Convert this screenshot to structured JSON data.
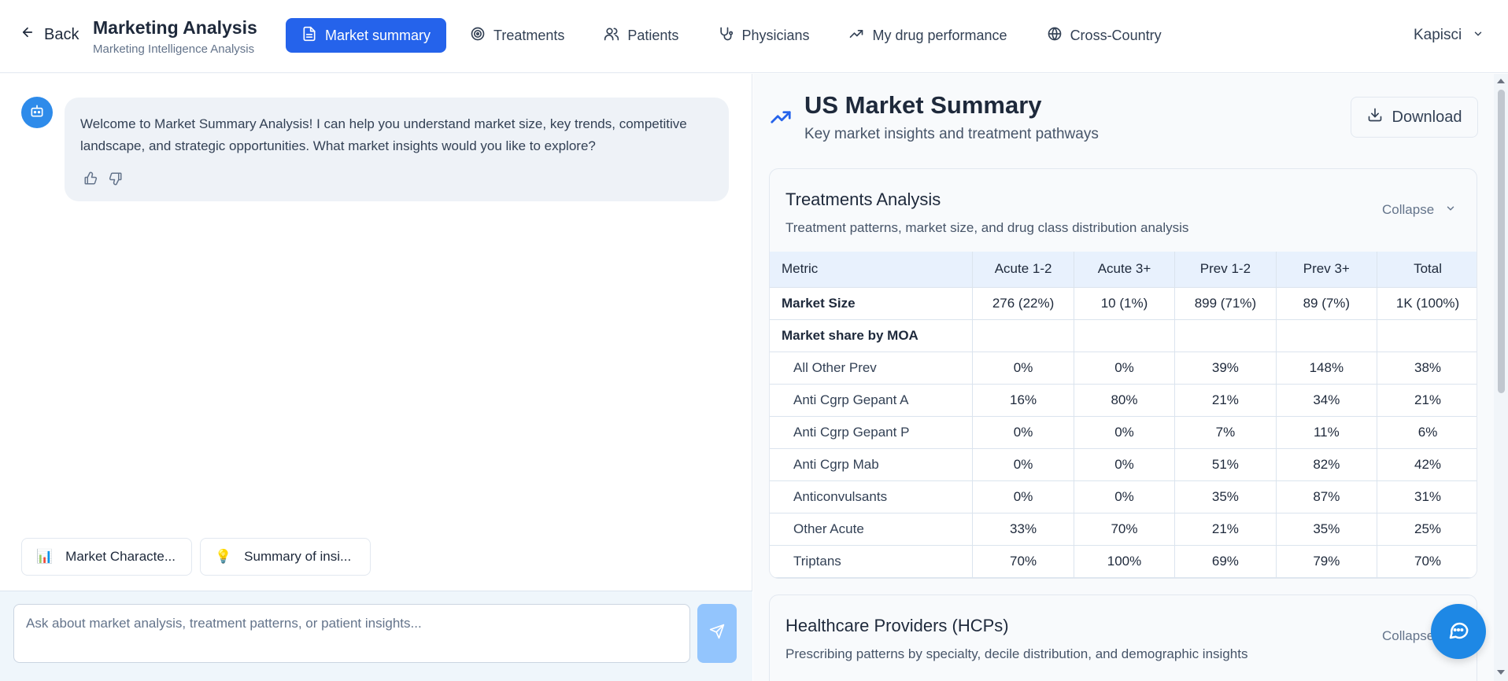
{
  "header": {
    "back_label": "Back",
    "title": "Marketing Analysis",
    "subtitle": "Marketing Intelligence Analysis",
    "tabs": [
      {
        "label": "Market summary",
        "icon": "document-icon",
        "active": true
      },
      {
        "label": "Treatments",
        "icon": "target-icon",
        "active": false
      },
      {
        "label": "Patients",
        "icon": "users-icon",
        "active": false
      },
      {
        "label": "Physicians",
        "icon": "stethoscope-icon",
        "active": false
      },
      {
        "label": "My drug performance",
        "icon": "trending-up-icon",
        "active": false
      },
      {
        "label": "Cross-Country",
        "icon": "globe-icon",
        "active": false
      }
    ],
    "user": "Kapisci"
  },
  "chat": {
    "welcome": "Welcome to Market Summary Analysis! I can help you understand market size, key trends, competitive landscape, and strategic opportunities. What market insights would you like to explore?",
    "chips": [
      {
        "emoji": "📊",
        "label": "Market Characte..."
      },
      {
        "emoji": "💡",
        "label": "Summary of insi..."
      }
    ],
    "input_placeholder": "Ask about market analysis, treatment patterns, or patient insights..."
  },
  "summary": {
    "title": "US Market Summary",
    "subtitle": "Key market insights and treatment pathways",
    "download_label": "Download"
  },
  "treatments": {
    "title": "Treatments Analysis",
    "subtitle": "Treatment patterns, market size, and drug class distribution analysis",
    "collapse_label": "Collapse",
    "columns": [
      "Metric",
      "Acute 1-2",
      "Acute 3+",
      "Prev 1-2",
      "Prev 3+",
      "Total"
    ],
    "market_size": {
      "label": "Market Size",
      "values": [
        "276 (22%)",
        "10 (1%)",
        "899 (71%)",
        "89 (7%)",
        "1K (100%)"
      ]
    },
    "moa_header": "Market share by MOA",
    "rows": [
      {
        "label": "All Other Prev",
        "values": [
          "0%",
          "0%",
          "39%",
          "148%",
          "38%"
        ]
      },
      {
        "label": "Anti Cgrp Gepant A",
        "values": [
          "16%",
          "80%",
          "21%",
          "34%",
          "21%"
        ]
      },
      {
        "label": "Anti Cgrp Gepant P",
        "values": [
          "0%",
          "0%",
          "7%",
          "11%",
          "6%"
        ]
      },
      {
        "label": "Anti Cgrp Mab",
        "values": [
          "0%",
          "0%",
          "51%",
          "82%",
          "42%"
        ]
      },
      {
        "label": "Anticonvulsants",
        "values": [
          "0%",
          "0%",
          "35%",
          "87%",
          "31%"
        ]
      },
      {
        "label": "Other Acute",
        "values": [
          "33%",
          "70%",
          "21%",
          "35%",
          "25%"
        ]
      },
      {
        "label": "Triptans",
        "values": [
          "70%",
          "100%",
          "69%",
          "79%",
          "70%"
        ]
      }
    ]
  },
  "hcp": {
    "title": "Healthcare Providers (HCPs)",
    "subtitle": "Prescribing patterns by specialty, decile distribution, and demographic insights",
    "collapse_label": "Collapse"
  },
  "colors": {
    "primary": "#2563eb",
    "send_disabled": "#93c5fd",
    "fab": "#1e88e5",
    "header_row": "#e8f1fd"
  }
}
